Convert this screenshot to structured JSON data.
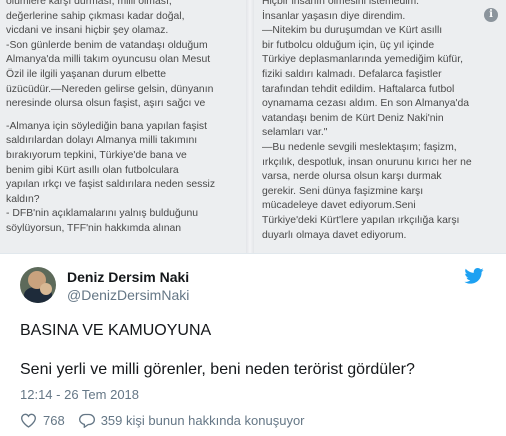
{
  "letter": {
    "left_column": [
      "ölümlere karşı durması, milli olması,",
      "değerlerine sahip çıkması kadar doğal,",
      "vicdani ve insani hiçbir şey olamaz.",
      "-Son günlerde benim de vatandaşı olduğum",
      "Almanya'da milli takım oyuncusu olan Mesut",
      "Özil ile ilgili yaşanan durum elbette",
      "üzücüdür.—Nereden gelirse gelsin, dünyanın",
      "neresinde olursa olsun faşist, aşırı sağcı ve",
      "",
      "-Almanya için söylediğin bana yapılan faşist",
      "saldırılardan dolayı Almanya milli takımını",
      "bırakıyorum tepkini, Türkiye'de bana ve",
      "benim gibi Kürt asıllı olan futbolculara",
      "yapılan ırkçı ve faşist saldırılara neden sessiz",
      "kaldın?",
      "- DFB'nin açıklamalarını yalnış bulduğunu",
      "söylüyorsun, TFF'nin hakkımda alınan"
    ],
    "right_column": [
      "Hiçbir insanın ölmesini istemedim.",
      "İnsanlar yaşasın diye direndim.",
      "—Nitekim bu duruşumdan ve Kürt asıllı",
      " bir futbolcu olduğum için, üç yıl içinde",
      "Türkiye deplasmanlarında yemediğim küfür,",
      "fiziki saldırı kalmadı. Defalarca faşistler",
      "tarafından tehdit edildim. Haftalarca futbol",
      "oynamama cezası aldım. En son Almanya'da",
      "vatandaşı benim de Kürt Deniz Naki'nin",
      "selamları var.\"",
      "—Bu nedenle sevgili meslektaşım; faşizm,",
      "ırkçılık, despotluk, insan onurunu kırıcı her ne",
      "varsa, nerde olursa olsun karşı durmak",
      "gerekir. Seni dünya faşizmine karşı",
      "mücadeleye davet ediyorum.Seni",
      "Türkiye'deki Kürt'lere yapılan ırkçılığa karşı",
      "duyarlı olmaya davet ediyorum."
    ]
  },
  "tweet": {
    "name": "Deniz Dersim Naki",
    "handle": "@DenizDersimNaki",
    "text_line1": "BASINA VE KAMUOYUNA",
    "text_line2": "Seni yerli ve milli görenler, beni neden terörist gördüler?",
    "timestamp": "12:14 - 26 Tem 2018",
    "likes": "768",
    "replies_text": "359 kişi bunun hakkında konuşuyor"
  },
  "icons": {
    "info": "info-icon",
    "twitter": "twitter-bird-icon",
    "heart": "heart-icon",
    "reply": "reply-bubble-icon"
  },
  "colors": {
    "twitter_blue": "#1da1f2",
    "text_primary": "#14171a",
    "text_secondary": "#657786"
  }
}
